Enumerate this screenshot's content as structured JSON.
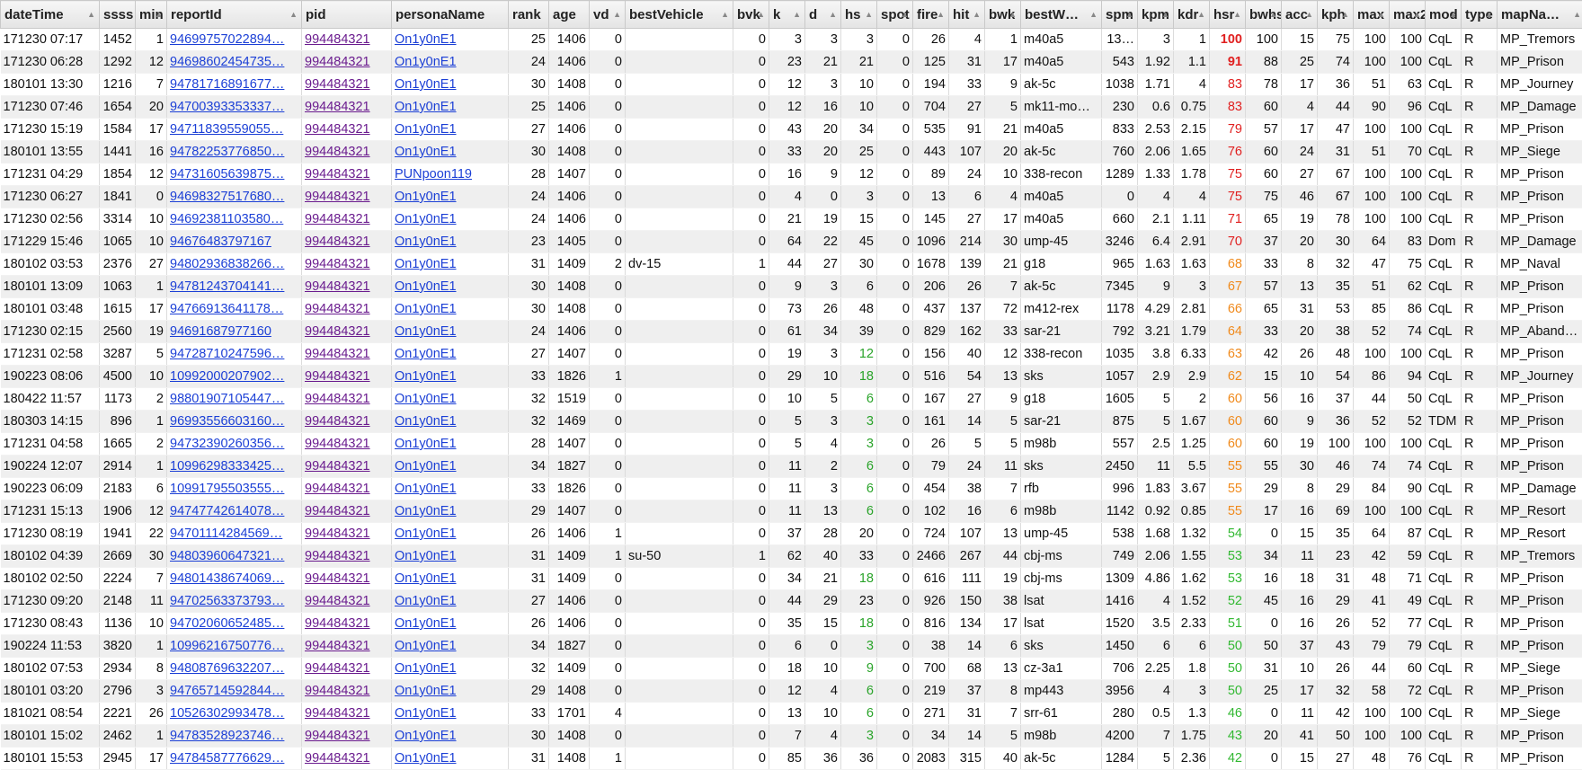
{
  "columns": [
    {
      "key": "dateTime",
      "label": "dateTime",
      "w": 110,
      "sort": true
    },
    {
      "key": "ssss",
      "label": "ssss",
      "w": 40,
      "num": true
    },
    {
      "key": "min",
      "label": "min",
      "w": 35,
      "num": true,
      "sort": true
    },
    {
      "key": "reportId",
      "label": "reportId",
      "w": 150,
      "sort": true
    },
    {
      "key": "pid",
      "label": "pid",
      "w": 100
    },
    {
      "key": "personaName",
      "label": "personaName",
      "w": 130
    },
    {
      "key": "rank",
      "label": "rank",
      "w": 45,
      "num": true
    },
    {
      "key": "age",
      "label": "age",
      "w": 45,
      "num": true
    },
    {
      "key": "vd",
      "label": "vd",
      "w": 40,
      "num": true,
      "sort": true
    },
    {
      "key": "bestVehicle",
      "label": "bestVehicle",
      "w": 120,
      "sort": true
    },
    {
      "key": "bvk",
      "label": "bvk",
      "w": 40,
      "num": true,
      "sort": true
    },
    {
      "key": "k",
      "label": "k",
      "w": 40,
      "num": true,
      "sort": true
    },
    {
      "key": "d",
      "label": "d",
      "w": 40,
      "num": true,
      "sort": true
    },
    {
      "key": "hs",
      "label": "hs",
      "w": 40,
      "num": true,
      "sort": true
    },
    {
      "key": "spot",
      "label": "spot",
      "w": 40,
      "num": true,
      "sort": true
    },
    {
      "key": "fire",
      "label": "fire",
      "w": 40,
      "num": true,
      "sort": true
    },
    {
      "key": "hit",
      "label": "hit",
      "w": 40,
      "num": true,
      "sort": true
    },
    {
      "key": "bwk",
      "label": "bwk",
      "w": 40,
      "num": true,
      "sort": true
    },
    {
      "key": "bestW",
      "label": "bestW…",
      "w": 90,
      "sort": true
    },
    {
      "key": "spm",
      "label": "spm",
      "w": 40,
      "num": true,
      "sort": true
    },
    {
      "key": "kpm",
      "label": "kpm",
      "w": 40,
      "num": true,
      "sort": true
    },
    {
      "key": "kdr",
      "label": "kdr",
      "w": 40,
      "num": true,
      "sort": true
    },
    {
      "key": "hsr",
      "label": "hsr",
      "w": 40,
      "num": true,
      "sort": true
    },
    {
      "key": "bwhs",
      "label": "bwhs",
      "w": 40,
      "num": true,
      "sort": true
    },
    {
      "key": "acc",
      "label": "acc",
      "w": 40,
      "num": true,
      "sort": true
    },
    {
      "key": "kph",
      "label": "kph",
      "w": 40,
      "num": true,
      "sort": true
    },
    {
      "key": "max",
      "label": "max",
      "w": 40,
      "num": true,
      "sort": true
    },
    {
      "key": "max2",
      "label": "max2",
      "w": 40,
      "num": true,
      "sort": true
    },
    {
      "key": "mod",
      "label": "mod",
      "w": 40,
      "sort": true
    },
    {
      "key": "type",
      "label": "type",
      "w": 40,
      "sort": true
    },
    {
      "key": "mapName",
      "label": "mapNa…",
      "w": 98,
      "sort": true
    }
  ],
  "rows": [
    [
      "171230 07:17",
      "1452",
      "1",
      "94699757022894…",
      "994484321",
      "On1y0nE1",
      "25",
      "1406",
      "0",
      "",
      "0",
      "3",
      "3",
      "3",
      "0",
      "26",
      "4",
      "1",
      "m40a5",
      "13…",
      "3",
      "1",
      "100",
      "100",
      "15",
      "75",
      "100",
      "100",
      "CqL",
      "R",
      "MP_Tremors"
    ],
    [
      "171230 06:28",
      "1292",
      "12",
      "94698602454735…",
      "994484321",
      "On1y0nE1",
      "24",
      "1406",
      "0",
      "",
      "0",
      "23",
      "21",
      "21",
      "0",
      "125",
      "31",
      "17",
      "m40a5",
      "543",
      "1.92",
      "1.1",
      "91",
      "88",
      "25",
      "74",
      "100",
      "100",
      "CqL",
      "R",
      "MP_Prison"
    ],
    [
      "180101 13:30",
      "1216",
      "7",
      "94781716891677…",
      "994484321",
      "On1y0nE1",
      "30",
      "1408",
      "0",
      "",
      "0",
      "12",
      "3",
      "10",
      "0",
      "194",
      "33",
      "9",
      "ak-5c",
      "1038",
      "1.71",
      "4",
      "83",
      "78",
      "17",
      "36",
      "51",
      "63",
      "CqL",
      "R",
      "MP_Journey"
    ],
    [
      "171230 07:46",
      "1654",
      "20",
      "94700393353337…",
      "994484321",
      "On1y0nE1",
      "25",
      "1406",
      "0",
      "",
      "0",
      "12",
      "16",
      "10",
      "0",
      "704",
      "27",
      "5",
      "mk11-mo…",
      "230",
      "0.6",
      "0.75",
      "83",
      "60",
      "4",
      "44",
      "90",
      "96",
      "CqL",
      "R",
      "MP_Damage"
    ],
    [
      "171230 15:19",
      "1584",
      "17",
      "94711839559055…",
      "994484321",
      "On1y0nE1",
      "27",
      "1406",
      "0",
      "",
      "0",
      "43",
      "20",
      "34",
      "0",
      "535",
      "91",
      "21",
      "m40a5",
      "833",
      "2.53",
      "2.15",
      "79",
      "57",
      "17",
      "47",
      "100",
      "100",
      "CqL",
      "R",
      "MP_Prison"
    ],
    [
      "180101 13:55",
      "1441",
      "16",
      "94782253776850…",
      "994484321",
      "On1y0nE1",
      "30",
      "1408",
      "0",
      "",
      "0",
      "33",
      "20",
      "25",
      "0",
      "443",
      "107",
      "20",
      "ak-5c",
      "760",
      "2.06",
      "1.65",
      "76",
      "60",
      "24",
      "31",
      "51",
      "70",
      "CqL",
      "R",
      "MP_Siege"
    ],
    [
      "171231 04:29",
      "1854",
      "12",
      "94731605639875…",
      "994484321",
      "PUNpoon119",
      "28",
      "1407",
      "0",
      "",
      "0",
      "16",
      "9",
      "12",
      "0",
      "89",
      "24",
      "10",
      "338-recon",
      "1289",
      "1.33",
      "1.78",
      "75",
      "60",
      "27",
      "67",
      "100",
      "100",
      "CqL",
      "R",
      "MP_Prison"
    ],
    [
      "171230 06:27",
      "1841",
      "0",
      "94698327517680…",
      "994484321",
      "On1y0nE1",
      "24",
      "1406",
      "0",
      "",
      "0",
      "4",
      "0",
      "3",
      "0",
      "13",
      "6",
      "4",
      "m40a5",
      "0",
      "4",
      "4",
      "75",
      "75",
      "46",
      "67",
      "100",
      "100",
      "CqL",
      "R",
      "MP_Prison"
    ],
    [
      "171230 02:56",
      "3314",
      "10",
      "94692381103580…",
      "994484321",
      "On1y0nE1",
      "24",
      "1406",
      "0",
      "",
      "0",
      "21",
      "19",
      "15",
      "0",
      "145",
      "27",
      "17",
      "m40a5",
      "660",
      "2.1",
      "1.11",
      "71",
      "65",
      "19",
      "78",
      "100",
      "100",
      "CqL",
      "R",
      "MP_Prison"
    ],
    [
      "171229 15:46",
      "1065",
      "10",
      "94676483797167",
      "994484321",
      "On1y0nE1",
      "23",
      "1405",
      "0",
      "",
      "0",
      "64",
      "22",
      "45",
      "0",
      "1096",
      "214",
      "30",
      "ump-45",
      "3246",
      "6.4",
      "2.91",
      "70",
      "37",
      "20",
      "30",
      "64",
      "83",
      "Dom",
      "R",
      "MP_Damage"
    ],
    [
      "180102 03:53",
      "2376",
      "27",
      "94802936838266…",
      "994484321",
      "On1y0nE1",
      "31",
      "1409",
      "2",
      "dv-15",
      "1",
      "44",
      "27",
      "30",
      "0",
      "1678",
      "139",
      "21",
      "g18",
      "965",
      "1.63",
      "1.63",
      "68",
      "33",
      "8",
      "32",
      "47",
      "75",
      "CqL",
      "R",
      "MP_Naval"
    ],
    [
      "180101 13:09",
      "1063",
      "1",
      "94781243704141…",
      "994484321",
      "On1y0nE1",
      "30",
      "1408",
      "0",
      "",
      "0",
      "9",
      "3",
      "6",
      "0",
      "206",
      "26",
      "7",
      "ak-5c",
      "7345",
      "9",
      "3",
      "67",
      "57",
      "13",
      "35",
      "51",
      "62",
      "CqL",
      "R",
      "MP_Prison"
    ],
    [
      "180101 03:48",
      "1615",
      "17",
      "94766913641178…",
      "994484321",
      "On1y0nE1",
      "30",
      "1408",
      "0",
      "",
      "0",
      "73",
      "26",
      "48",
      "0",
      "437",
      "137",
      "72",
      "m412-rex",
      "1178",
      "4.29",
      "2.81",
      "66",
      "65",
      "31",
      "53",
      "85",
      "86",
      "CqL",
      "R",
      "MP_Prison"
    ],
    [
      "171230 02:15",
      "2560",
      "19",
      "94691687977160",
      "994484321",
      "On1y0nE1",
      "24",
      "1406",
      "0",
      "",
      "0",
      "61",
      "34",
      "39",
      "0",
      "829",
      "162",
      "33",
      "sar-21",
      "792",
      "3.21",
      "1.79",
      "64",
      "33",
      "20",
      "38",
      "52",
      "74",
      "CqL",
      "R",
      "MP_Abando…"
    ],
    [
      "171231 02:58",
      "3287",
      "5",
      "94728710247596…",
      "994484321",
      "On1y0nE1",
      "27",
      "1407",
      "0",
      "",
      "0",
      "19",
      "3",
      "12",
      "0",
      "156",
      "40",
      "12",
      "338-recon",
      "1035",
      "3.8",
      "6.33",
      "63",
      "42",
      "26",
      "48",
      "100",
      "100",
      "CqL",
      "R",
      "MP_Prison"
    ],
    [
      "190223 08:06",
      "4500",
      "10",
      "10992000207902…",
      "994484321",
      "On1y0nE1",
      "33",
      "1826",
      "1",
      "",
      "0",
      "29",
      "10",
      "18",
      "0",
      "516",
      "54",
      "13",
      "sks",
      "1057",
      "2.9",
      "2.9",
      "62",
      "15",
      "10",
      "54",
      "86",
      "94",
      "CqL",
      "R",
      "MP_Journey"
    ],
    [
      "180422 11:57",
      "1173",
      "2",
      "98801907105447…",
      "994484321",
      "On1y0nE1",
      "32",
      "1519",
      "0",
      "",
      "0",
      "10",
      "5",
      "6",
      "0",
      "167",
      "27",
      "9",
      "g18",
      "1605",
      "5",
      "2",
      "60",
      "56",
      "16",
      "37",
      "44",
      "50",
      "CqL",
      "R",
      "MP_Prison"
    ],
    [
      "180303 14:15",
      "896",
      "1",
      "96993556603160…",
      "994484321",
      "On1y0nE1",
      "32",
      "1469",
      "0",
      "",
      "0",
      "5",
      "3",
      "3",
      "0",
      "161",
      "14",
      "5",
      "sar-21",
      "875",
      "5",
      "1.67",
      "60",
      "60",
      "9",
      "36",
      "52",
      "52",
      "TDM",
      "R",
      "MP_Prison"
    ],
    [
      "171231 04:58",
      "1665",
      "2",
      "94732390260356…",
      "994484321",
      "On1y0nE1",
      "28",
      "1407",
      "0",
      "",
      "0",
      "5",
      "4",
      "3",
      "0",
      "26",
      "5",
      "5",
      "m98b",
      "557",
      "2.5",
      "1.25",
      "60",
      "60",
      "19",
      "100",
      "100",
      "100",
      "CqL",
      "R",
      "MP_Prison"
    ],
    [
      "190224 12:07",
      "2914",
      "1",
      "10996298333425…",
      "994484321",
      "On1y0nE1",
      "34",
      "1827",
      "0",
      "",
      "0",
      "11",
      "2",
      "6",
      "0",
      "79",
      "24",
      "11",
      "sks",
      "2450",
      "11",
      "5.5",
      "55",
      "55",
      "30",
      "46",
      "74",
      "74",
      "CqL",
      "R",
      "MP_Prison"
    ],
    [
      "190223 06:09",
      "2183",
      "6",
      "10991795503555…",
      "994484321",
      "On1y0nE1",
      "33",
      "1826",
      "0",
      "",
      "0",
      "11",
      "3",
      "6",
      "0",
      "454",
      "38",
      "7",
      "rfb",
      "996",
      "1.83",
      "3.67",
      "55",
      "29",
      "8",
      "29",
      "84",
      "90",
      "CqL",
      "R",
      "MP_Damage"
    ],
    [
      "171231 15:13",
      "1906",
      "12",
      "94747742614078…",
      "994484321",
      "On1y0nE1",
      "29",
      "1407",
      "0",
      "",
      "0",
      "11",
      "13",
      "6",
      "0",
      "102",
      "16",
      "6",
      "m98b",
      "1142",
      "0.92",
      "0.85",
      "55",
      "17",
      "16",
      "69",
      "100",
      "100",
      "CqL",
      "R",
      "MP_Resort"
    ],
    [
      "171230 08:19",
      "1941",
      "22",
      "94701114284569…",
      "994484321",
      "On1y0nE1",
      "26",
      "1406",
      "1",
      "",
      "0",
      "37",
      "28",
      "20",
      "0",
      "724",
      "107",
      "13",
      "ump-45",
      "538",
      "1.68",
      "1.32",
      "54",
      "0",
      "15",
      "35",
      "64",
      "87",
      "CqL",
      "R",
      "MP_Resort"
    ],
    [
      "180102 04:39",
      "2669",
      "30",
      "94803960647321…",
      "994484321",
      "On1y0nE1",
      "31",
      "1409",
      "1",
      "su-50",
      "1",
      "62",
      "40",
      "33",
      "0",
      "2466",
      "267",
      "44",
      "cbj-ms",
      "749",
      "2.06",
      "1.55",
      "53",
      "34",
      "11",
      "23",
      "42",
      "59",
      "CqL",
      "R",
      "MP_Tremors"
    ],
    [
      "180102 02:50",
      "2224",
      "7",
      "94801438674069…",
      "994484321",
      "On1y0nE1",
      "31",
      "1409",
      "0",
      "",
      "0",
      "34",
      "21",
      "18",
      "0",
      "616",
      "111",
      "19",
      "cbj-ms",
      "1309",
      "4.86",
      "1.62",
      "53",
      "16",
      "18",
      "31",
      "48",
      "71",
      "CqL",
      "R",
      "MP_Prison"
    ],
    [
      "171230 09:20",
      "2148",
      "11",
      "94702563373793…",
      "994484321",
      "On1y0nE1",
      "27",
      "1406",
      "0",
      "",
      "0",
      "44",
      "29",
      "23",
      "0",
      "926",
      "150",
      "38",
      "lsat",
      "1416",
      "4",
      "1.52",
      "52",
      "45",
      "16",
      "29",
      "41",
      "49",
      "CqL",
      "R",
      "MP_Prison"
    ],
    [
      "171230 08:43",
      "1136",
      "10",
      "94702060652485…",
      "994484321",
      "On1y0nE1",
      "26",
      "1406",
      "0",
      "",
      "0",
      "35",
      "15",
      "18",
      "0",
      "816",
      "134",
      "17",
      "lsat",
      "1520",
      "3.5",
      "2.33",
      "51",
      "0",
      "16",
      "26",
      "52",
      "77",
      "CqL",
      "R",
      "MP_Prison"
    ],
    [
      "190224 11:53",
      "3820",
      "1",
      "10996216750776…",
      "994484321",
      "On1y0nE1",
      "34",
      "1827",
      "0",
      "",
      "0",
      "6",
      "0",
      "3",
      "0",
      "38",
      "14",
      "6",
      "sks",
      "1450",
      "6",
      "6",
      "50",
      "50",
      "37",
      "43",
      "79",
      "79",
      "CqL",
      "R",
      "MP_Prison"
    ],
    [
      "180102 07:53",
      "2934",
      "8",
      "94808769632207…",
      "994484321",
      "On1y0nE1",
      "32",
      "1409",
      "0",
      "",
      "0",
      "18",
      "10",
      "9",
      "0",
      "700",
      "68",
      "13",
      "cz-3a1",
      "706",
      "2.25",
      "1.8",
      "50",
      "31",
      "10",
      "26",
      "44",
      "60",
      "CqL",
      "R",
      "MP_Siege"
    ],
    [
      "180101 03:20",
      "2796",
      "3",
      "94765714592844…",
      "994484321",
      "On1y0nE1",
      "29",
      "1408",
      "0",
      "",
      "0",
      "12",
      "4",
      "6",
      "0",
      "219",
      "37",
      "8",
      "mp443",
      "3956",
      "4",
      "3",
      "50",
      "25",
      "17",
      "32",
      "58",
      "72",
      "CqL",
      "R",
      "MP_Prison"
    ],
    [
      "181021 08:54",
      "2221",
      "26",
      "10526302993478…",
      "994484321",
      "On1y0nE1",
      "33",
      "1701",
      "4",
      "",
      "0",
      "13",
      "10",
      "6",
      "0",
      "271",
      "31",
      "7",
      "srr-61",
      "280",
      "0.5",
      "1.3",
      "46",
      "0",
      "11",
      "42",
      "100",
      "100",
      "CqL",
      "R",
      "MP_Siege"
    ],
    [
      "180101 15:02",
      "2462",
      "1",
      "94783528923746…",
      "994484321",
      "On1y0nE1",
      "30",
      "1408",
      "0",
      "",
      "0",
      "7",
      "4",
      "3",
      "0",
      "34",
      "14",
      "5",
      "m98b",
      "4200",
      "7",
      "1.75",
      "43",
      "20",
      "41",
      "50",
      "100",
      "100",
      "CqL",
      "R",
      "MP_Prison"
    ],
    [
      "180101 15:53",
      "2945",
      "17",
      "94784587776629…",
      "994484321",
      "On1y0nE1",
      "31",
      "1408",
      "1",
      "",
      "0",
      "85",
      "36",
      "36",
      "0",
      "2083",
      "315",
      "40",
      "ak-5c",
      "1284",
      "5",
      "2.36",
      "42",
      "0",
      "15",
      "27",
      "48",
      "76",
      "CqL",
      "R",
      "MP_Prison"
    ]
  ],
  "colors": {
    "hsrRed": "#e02020",
    "hsrOrange": "#f08a1c",
    "hsrGreen": "#32b832",
    "hsGreen": "#29a329",
    "link": "#1b3fd6",
    "visited": "#6a1b8e"
  }
}
